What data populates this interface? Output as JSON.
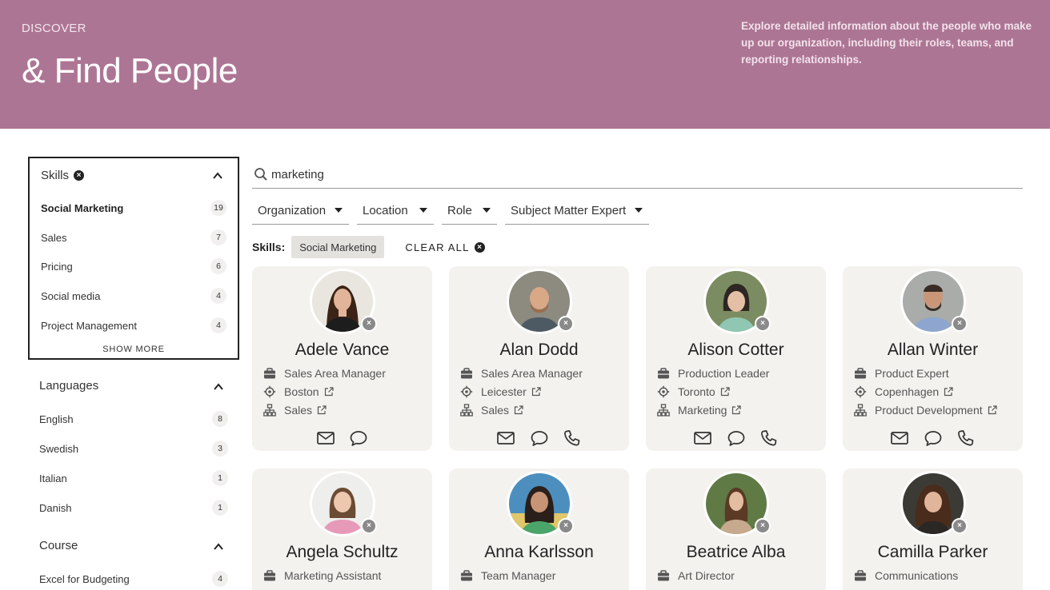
{
  "header": {
    "eyebrow": "DISCOVER",
    "title": "& Find People",
    "description": "Explore detailed information about the people who make up our organization, including their roles, teams, and reporting relationships."
  },
  "facets": {
    "skills": {
      "title": "Skills",
      "items": [
        {
          "label": "Social Marketing",
          "count": "19"
        },
        {
          "label": "Sales",
          "count": "7"
        },
        {
          "label": "Pricing",
          "count": "6"
        },
        {
          "label": "Social media",
          "count": "4"
        },
        {
          "label": "Project Management",
          "count": "4"
        }
      ],
      "show_more": "SHOW MORE"
    },
    "languages": {
      "title": "Languages",
      "items": [
        {
          "label": "English",
          "count": "8"
        },
        {
          "label": "Swedish",
          "count": "3"
        },
        {
          "label": "Italian",
          "count": "1"
        },
        {
          "label": "Danish",
          "count": "1"
        }
      ]
    },
    "course": {
      "title": "Course",
      "items": [
        {
          "label": "Excel for Budgeting",
          "count": "4"
        }
      ]
    }
  },
  "search": {
    "value": "marketing"
  },
  "filters": [
    "Organization",
    "Location",
    "Role",
    "Subject Matter Expert"
  ],
  "active_filters": {
    "label": "Skills:",
    "chips": [
      "Social Marketing"
    ],
    "clear_all": "CLEAR ALL"
  },
  "people": [
    {
      "name": "Adele Vance",
      "role": "Sales Area Manager",
      "location": "Boston",
      "department": "Sales"
    },
    {
      "name": "Alan Dodd",
      "role": "Sales Area Manager",
      "location": "Leicester",
      "department": "Sales"
    },
    {
      "name": "Alison Cotter",
      "role": "Production Leader",
      "location": "Toronto",
      "department": "Marketing"
    },
    {
      "name": "Allan Winter",
      "role": "Product Expert",
      "location": "Copenhagen",
      "department": "Product Development"
    },
    {
      "name": "Angela Schultz",
      "role": "Marketing Assistant"
    },
    {
      "name": "Anna Karlsson",
      "role": "Team Manager"
    },
    {
      "name": "Beatrice Alba",
      "role": "Art Director"
    },
    {
      "name": "Camilla Parker",
      "role": "Communications"
    }
  ],
  "colors": {
    "header_bg": "#ad7594",
    "card_bg": "#f3f2ef",
    "count_bg": "#f1f0ee"
  },
  "icons": [
    "search-icon",
    "briefcase-icon",
    "location-icon",
    "org-chart-icon",
    "external-link-icon",
    "mail-icon",
    "chat-icon",
    "phone-icon",
    "remove-icon",
    "chevron-up-icon",
    "caret-down-icon"
  ]
}
